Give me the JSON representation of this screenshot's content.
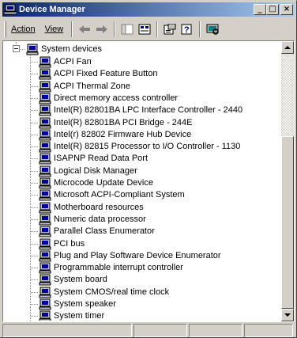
{
  "window": {
    "title": "Device Manager",
    "controls": {
      "minimize": "_",
      "maximize": "□",
      "close": "×"
    }
  },
  "menu": {
    "action": "Action",
    "view": "View"
  },
  "toolbar_icons": [
    "back-arrow-icon",
    "forward-arrow-icon",
    "console-tree-icon",
    "details-view-icon",
    "properties-icon",
    "help-icon",
    "scan-hardware-icon"
  ],
  "tree": {
    "category": "System devices",
    "devices": [
      "ACPI Fan",
      "ACPI Fixed Feature Button",
      "ACPI Thermal Zone",
      "Direct memory access controller",
      "Intel(R) 82801BA LPC Interface Controller - 2440",
      "Intel(R) 82801BA PCI Bridge - 244E",
      "Intel(r) 82802 Firmware Hub Device",
      "Intel(R) 82815 Processor to I/O Controller - 1130",
      "ISAPNP Read Data Port",
      "Logical Disk Manager",
      "Microcode Update Device",
      "Microsoft ACPI-Compliant System",
      "Motherboard resources",
      "Numeric data processor",
      "Parallel Class Enumerator",
      "PCI bus",
      "Plug and Play Software Device Enumerator",
      "Programmable interrupt controller",
      "System board",
      "System CMOS/real time clock",
      "System speaker",
      "System timer"
    ]
  },
  "colors": {
    "title_start": "#0a246a",
    "title_end": "#a6caf0",
    "face": "#d4d0c8"
  }
}
